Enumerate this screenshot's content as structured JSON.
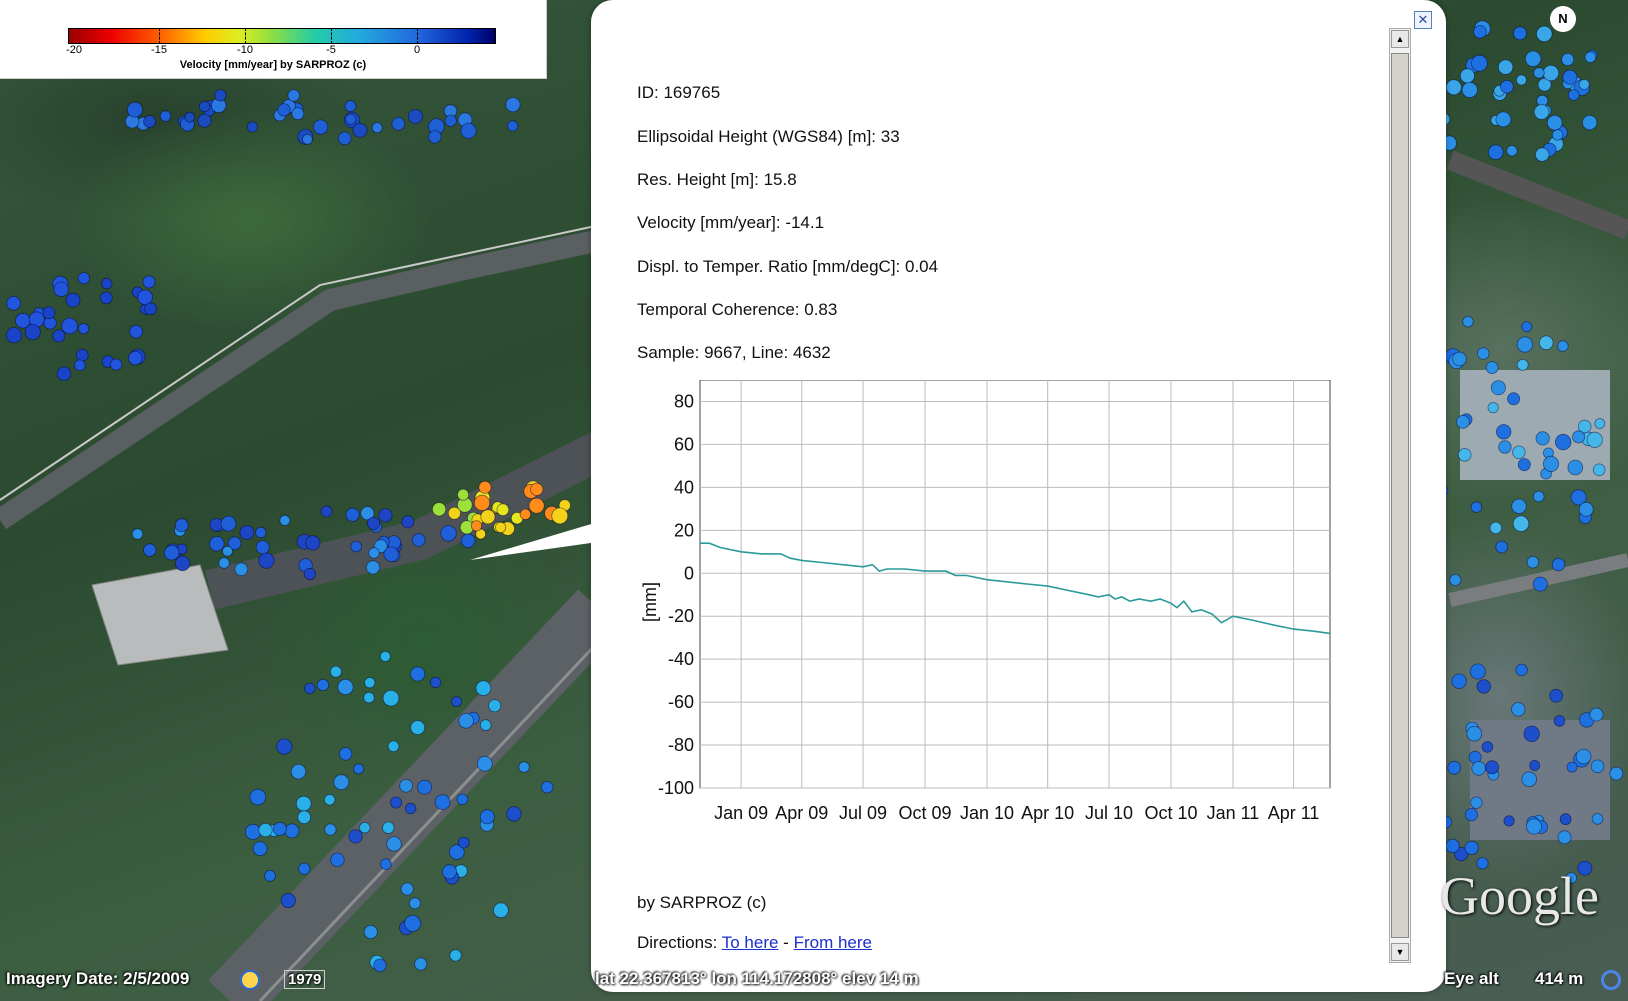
{
  "legend": {
    "ticks": [
      "-20",
      "-15",
      "-10",
      "-5",
      "0"
    ],
    "caption": "Velocity [mm/year]  by  SARPROZ (c)"
  },
  "balloon": {
    "id_line": "ID: 169765",
    "ellipsoidal_height": "Ellipsoidal Height (WGS84) [m]: 33",
    "res_height": "Res. Height [m]: 15.8",
    "velocity": "Velocity [mm/year]: -14.1",
    "displ_ratio": "Displ. to Temper. Ratio [mm/degC]: 0.04",
    "temporal_coherence": "Temporal Coherence: 0.83",
    "sample_line": "Sample: 9667, Line: 4632",
    "footer": "by SARPROZ (c)",
    "directions_label": "Directions:",
    "to_here": "To here",
    "separator": "-",
    "from_here": "From here",
    "close_icon": "close-icon"
  },
  "chart_data": {
    "type": "line",
    "ylabel": "[mm]",
    "xlabel": "",
    "ylim": [
      -100,
      90
    ],
    "yticks": [
      "80",
      "60",
      "40",
      "20",
      "0",
      "-20",
      "-40",
      "-60",
      "-80",
      "-100"
    ],
    "ytick_values": [
      80,
      60,
      40,
      20,
      0,
      -20,
      -40,
      -60,
      -80,
      -100
    ],
    "xlim": [
      "2008-11-01",
      "2011-05-25"
    ],
    "xticks": [
      {
        "label": "Jan 09",
        "date": "2009-01-01"
      },
      {
        "label": "Apr 09",
        "date": "2009-04-01"
      },
      {
        "label": "Jul 09",
        "date": "2009-07-01"
      },
      {
        "label": "Oct 09",
        "date": "2009-10-01"
      },
      {
        "label": "Jan 10",
        "date": "2010-01-01"
      },
      {
        "label": "Apr 10",
        "date": "2010-04-01"
      },
      {
        "label": "Jul 10",
        "date": "2010-07-01"
      },
      {
        "label": "Oct 10",
        "date": "2010-10-01"
      },
      {
        "label": "Jan 11",
        "date": "2011-01-01"
      },
      {
        "label": "Apr 11",
        "date": "2011-04-01"
      }
    ],
    "grid": true,
    "line_color": "#2a9a9a",
    "series": [
      {
        "x": [
          "2008-11-01",
          "2008-11-15",
          "2008-12-01",
          "2009-01-01",
          "2009-02-01",
          "2009-03-01",
          "2009-03-15",
          "2009-04-01",
          "2009-05-01",
          "2009-06-01",
          "2009-07-01",
          "2009-07-15",
          "2009-07-25",
          "2009-08-05",
          "2009-09-01",
          "2009-10-01",
          "2009-11-01",
          "2009-11-15",
          "2009-12-01",
          "2010-01-01",
          "2010-02-01",
          "2010-03-01",
          "2010-04-01",
          "2010-05-01",
          "2010-06-01",
          "2010-06-15",
          "2010-07-01",
          "2010-07-10",
          "2010-07-20",
          "2010-08-01",
          "2010-08-15",
          "2010-09-01",
          "2010-09-15",
          "2010-10-01",
          "2010-10-10",
          "2010-10-20",
          "2010-11-01",
          "2010-11-15",
          "2010-12-01",
          "2010-12-15",
          "2011-01-01",
          "2011-02-01",
          "2011-03-01",
          "2011-04-01",
          "2011-05-01",
          "2011-05-25"
        ],
        "y": [
          14,
          14,
          12,
          10,
          9,
          9,
          7,
          6,
          5,
          4,
          3,
          4,
          1,
          2,
          2,
          1,
          1,
          -1,
          -1,
          -3,
          -4,
          -5,
          -6,
          -8,
          -10,
          -11,
          -10,
          -12,
          -11,
          -13,
          -12,
          -13,
          -12,
          -14,
          -16,
          -13,
          -18,
          -17,
          -19,
          -23,
          -20,
          -22,
          -24,
          -26,
          -27,
          -28
        ]
      }
    ]
  },
  "status": {
    "imagery_date": "Imagery Date: 2/5/2009",
    "year": "1979",
    "coords": "lat   22.367813°  lon   114.172808°  elev   14 m",
    "eye_alt_label": "Eye alt",
    "eye_alt_value": "414 m"
  },
  "map": {
    "logo": "Google",
    "north": "N"
  }
}
